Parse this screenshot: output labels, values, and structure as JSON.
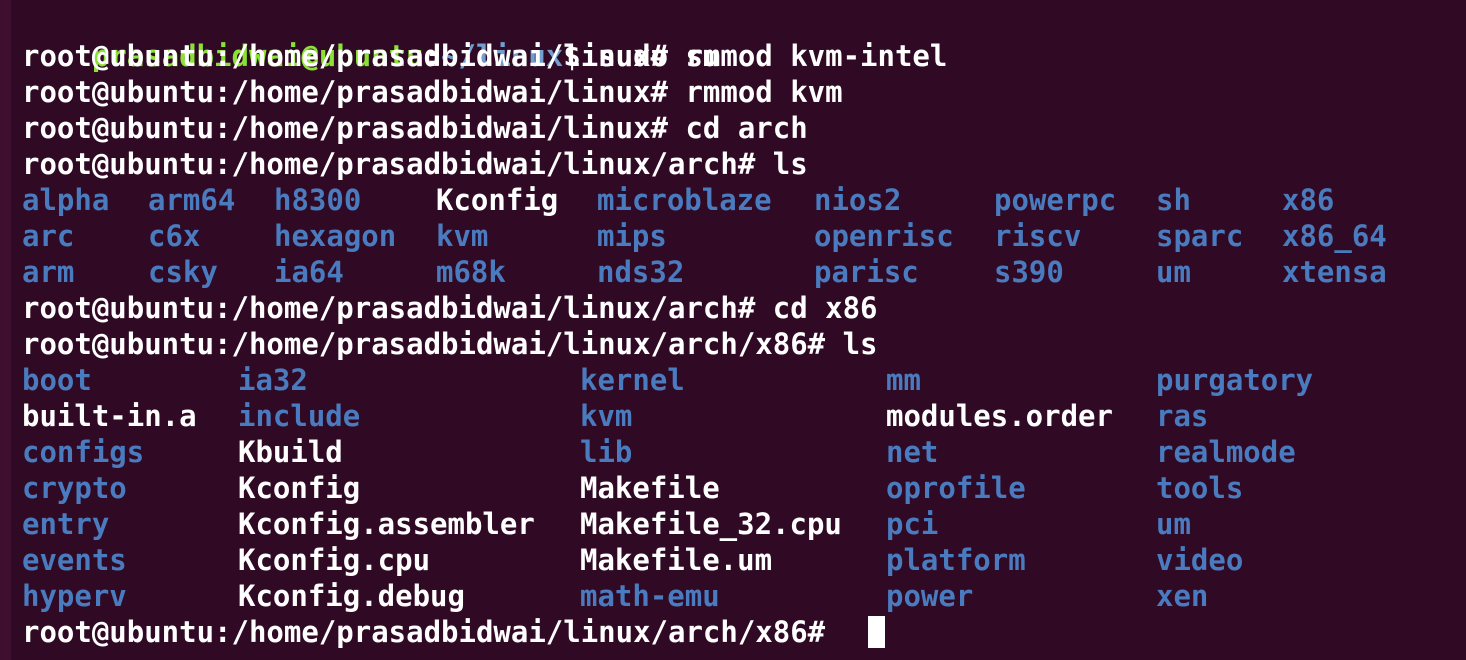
{
  "terminal": {
    "first_prompt": {
      "user_host": "prasadbidwai@ubuntu",
      "colon": ":",
      "path": "~/linux",
      "symbol": "$",
      "command": " sudo su"
    },
    "history": [
      "root@ubuntu:/home/prasadbidwai/linux# rmmod kvm-intel",
      "root@ubuntu:/home/prasadbidwai/linux# rmmod kvm",
      "root@ubuntu:/home/prasadbidwai/linux# cd arch",
      "root@ubuntu:/home/prasadbidwai/linux/arch# ls"
    ],
    "arch_listing": [
      [
        {
          "name": "alpha",
          "type": "dir"
        },
        {
          "name": "arm64",
          "type": "dir"
        },
        {
          "name": "h8300",
          "type": "dir"
        },
        {
          "name": "Kconfig",
          "type": "file"
        },
        {
          "name": "microblaze",
          "type": "dir"
        },
        {
          "name": "nios2",
          "type": "dir"
        },
        {
          "name": "powerpc",
          "type": "dir"
        },
        {
          "name": "sh",
          "type": "dir"
        },
        {
          "name": "x86",
          "type": "dir"
        }
      ],
      [
        {
          "name": "arc",
          "type": "dir"
        },
        {
          "name": "c6x",
          "type": "dir"
        },
        {
          "name": "hexagon",
          "type": "dir"
        },
        {
          "name": "kvm",
          "type": "dir"
        },
        {
          "name": "mips",
          "type": "dir"
        },
        {
          "name": "openrisc",
          "type": "dir"
        },
        {
          "name": "riscv",
          "type": "dir"
        },
        {
          "name": "sparc",
          "type": "dir"
        },
        {
          "name": "x86_64",
          "type": "dir"
        }
      ],
      [
        {
          "name": "arm",
          "type": "dir"
        },
        {
          "name": "csky",
          "type": "dir"
        },
        {
          "name": "ia64",
          "type": "dir"
        },
        {
          "name": "m68k",
          "type": "dir"
        },
        {
          "name": "nds32",
          "type": "dir"
        },
        {
          "name": "parisc",
          "type": "dir"
        },
        {
          "name": "s390",
          "type": "dir"
        },
        {
          "name": "um",
          "type": "dir"
        },
        {
          "name": "xtensa",
          "type": "dir"
        }
      ]
    ],
    "history2": [
      "root@ubuntu:/home/prasadbidwai/linux/arch# cd x86",
      "root@ubuntu:/home/prasadbidwai/linux/arch/x86# ls"
    ],
    "x86_listing": [
      [
        {
          "name": "boot",
          "type": "dir"
        },
        {
          "name": "ia32",
          "type": "dir"
        },
        {
          "name": "kernel",
          "type": "dir"
        },
        {
          "name": "mm",
          "type": "dir"
        },
        {
          "name": "purgatory",
          "type": "dir"
        }
      ],
      [
        {
          "name": "built-in.a",
          "type": "file"
        },
        {
          "name": "include",
          "type": "dir"
        },
        {
          "name": "kvm",
          "type": "dir"
        },
        {
          "name": "modules.order",
          "type": "file"
        },
        {
          "name": "ras",
          "type": "dir"
        }
      ],
      [
        {
          "name": "configs",
          "type": "dir"
        },
        {
          "name": "Kbuild",
          "type": "file"
        },
        {
          "name": "lib",
          "type": "dir"
        },
        {
          "name": "net",
          "type": "dir"
        },
        {
          "name": "realmode",
          "type": "dir"
        }
      ],
      [
        {
          "name": "crypto",
          "type": "dir"
        },
        {
          "name": "Kconfig",
          "type": "file"
        },
        {
          "name": "Makefile",
          "type": "file"
        },
        {
          "name": "oprofile",
          "type": "dir"
        },
        {
          "name": "tools",
          "type": "dir"
        }
      ],
      [
        {
          "name": "entry",
          "type": "dir"
        },
        {
          "name": "Kconfig.assembler",
          "type": "file"
        },
        {
          "name": "Makefile_32.cpu",
          "type": "file"
        },
        {
          "name": "pci",
          "type": "dir"
        },
        {
          "name": "um",
          "type": "dir"
        }
      ],
      [
        {
          "name": "events",
          "type": "dir"
        },
        {
          "name": "Kconfig.cpu",
          "type": "file"
        },
        {
          "name": "Makefile.um",
          "type": "file"
        },
        {
          "name": "platform",
          "type": "dir"
        },
        {
          "name": "video",
          "type": "dir"
        }
      ],
      [
        {
          "name": "hyperv",
          "type": "dir"
        },
        {
          "name": "Kconfig.debug",
          "type": "file"
        },
        {
          "name": "math-emu",
          "type": "dir"
        },
        {
          "name": "power",
          "type": "dir"
        },
        {
          "name": "xen",
          "type": "dir"
        }
      ]
    ],
    "current_prompt": "root@ubuntu:/home/prasadbidwai/linux/arch/x86# ",
    "colors": {
      "background": "#300a24",
      "user_host": "#8ae234",
      "path": "#729fcf",
      "directory": "#4a7bbf",
      "text": "#ffffff"
    }
  }
}
